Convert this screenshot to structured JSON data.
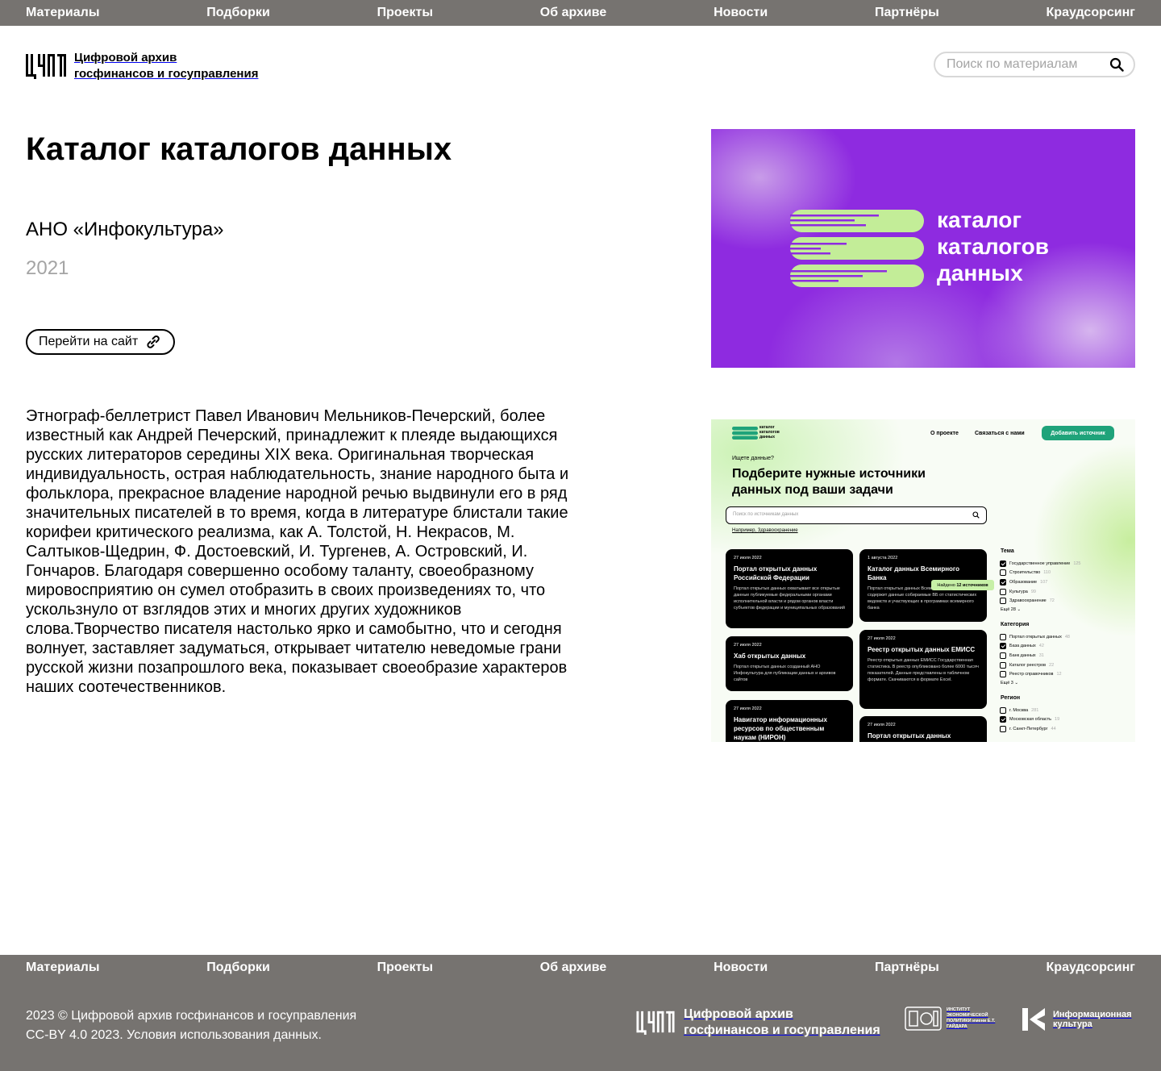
{
  "nav": {
    "items": [
      "Материалы",
      "Подборки",
      "Проекты",
      "Об архиве",
      "Новости",
      "Партнёры",
      "Краудсорсинг"
    ]
  },
  "header": {
    "logo_line1": "Цифровой архив",
    "logo_line2": "госфинансов и госуправления",
    "search_placeholder": "Поиск по материалам"
  },
  "page": {
    "title": "Каталог каталогов данных",
    "org": "АНО «Инфокультура»",
    "year": "2021",
    "site_button": "Перейти на сайт",
    "description": "Этнограф-беллетрист Павел Иванович Мельников-Печерский, более известный как Андрей Печерский, принадлежит к плеяде выдающихся русских литераторов середины XIX века. Оригинальная творческая индивидуальность, острая наблюдательность, знание народного быта и фольклора, прекрасное владение народной речью выдвинули его в ряд значительных писателей в то время, когда в литературе блистали такие корифеи критического реализма, как А. Толстой, Н. Некрасов, М. Салтыков-Щедрин, Ф. Достоевский, И. Тургенев, А. Островский, И. Гончаров. Благодаря совершенно особому таланту, своеобразному мировосприятию он сумел отобразить в своих произведениях то, что ускользнуло от взглядов этих и многих других художников слова.Творчество писателя настолько ярко и самобытно, что и сегодня волнует, заставляет задуматься, открывает читателю неведомые грани русской жизни позапрошлого века, показывает своеобразие характеров наших соотечественников."
  },
  "cover": {
    "line1": "каталог",
    "line2": "каталогов",
    "line3": "данных",
    "bg_color": "#8e2be0",
    "bars_color": "#c3ed98"
  },
  "preview": {
    "logo_line1": "каталог",
    "logo_line2": "каталогов",
    "logo_line3": "данных",
    "nav1": "О проекте",
    "nav2": "Связаться с нами",
    "add_button": "Добавить источник",
    "question": "Ищете данные?",
    "heading": "Подберите нужные источники данных под ваши задачи",
    "search_placeholder": "Поиск по источникам данных",
    "example": "Например, Здравоохранение",
    "found_prefix": "Найдено",
    "found_count": "12 источников",
    "cards": [
      {
        "date": "27 июля 2022",
        "title": "Портал открытых данных Российской Федерации",
        "text": "Портал открытых данных охватывает все открытые данные публикуемые федеральными органами исполнительной власти и рядом органов власти субъектов федерации и муниципальных образований"
      },
      {
        "date": "27 июля 2022",
        "title": "Хаб открытых данных",
        "text": "Портал открытых данных созданный АНО Инфокультура для публикации данных и архивов сайтов"
      },
      {
        "date": "27 июля 2022",
        "title": "Навигатор информационных ресурсов по общественным наукам (НИРОН)",
        "text": ""
      },
      {
        "date": "1 августа 2022",
        "title": "Каталог данных Всемирного Банка",
        "text": "Портал открытых данных Всемирного Банка содержит данные собираемые ВБ от статистических ведомств и участвующих в программах всемирного банка"
      },
      {
        "date": "27 июля 2022",
        "title": "Реестр открытых данных ЕМИСС",
        "text": "Реестр открытых данных ЕМИСС Государственная статистика. В реестр опубликовано более 6000 тысяч показателей. Данные представлены в табличном формате. Скачиваются в формате Excel."
      },
      {
        "date": "27 июля 2022",
        "title": "Портал открытых данных",
        "text": ""
      }
    ],
    "filters": [
      {
        "heading": "Тема",
        "more": "Ещё 28",
        "items": [
          {
            "label": "Государственное управление",
            "count": "125",
            "checked": true
          },
          {
            "label": "Строительство",
            "count": "110",
            "checked": false
          },
          {
            "label": "Образование",
            "count": "107",
            "checked": true
          },
          {
            "label": "Культура",
            "count": "99",
            "checked": false
          },
          {
            "label": "Здравоохранение",
            "count": "72",
            "checked": false
          }
        ]
      },
      {
        "heading": "Категория",
        "more": "Ещё 3",
        "items": [
          {
            "label": "Портал открытых данных",
            "count": "48",
            "checked": false
          },
          {
            "label": "База данных",
            "count": "42",
            "checked": true
          },
          {
            "label": "Банк данных",
            "count": "31",
            "checked": false
          },
          {
            "label": "Каталог реестров",
            "count": "22",
            "checked": false
          },
          {
            "label": "Реестр справочников",
            "count": "12",
            "checked": false
          }
        ]
      },
      {
        "heading": "Регион",
        "more": "",
        "items": [
          {
            "label": "г. Москва",
            "count": "281",
            "checked": false
          },
          {
            "label": "Московская область",
            "count": "19",
            "checked": true
          },
          {
            "label": "г. Санкт-Петербург",
            "count": "44",
            "checked": false
          }
        ]
      }
    ]
  },
  "footer": {
    "copyright": "2023 © Цифровой архив госфинансов и госуправления",
    "license": "CC-BY 4.0 2023. Условия использования данных.",
    "logo_line1": "Цифровой архив",
    "logo_line2": "госфинансов и госуправления",
    "gaidar_text": "ИНСТИТУТ ЭКОНОМИЧЕСКОЙ ПОЛИТИКИ имени Е.Т. ГАЙДАРА",
    "infoculture_line1": "Информационная",
    "infoculture_line2": "культура"
  },
  "colors": {
    "nav_bg": "#767370",
    "muted_text": "#a4a4a4",
    "accent_green": "#1fa37a"
  }
}
